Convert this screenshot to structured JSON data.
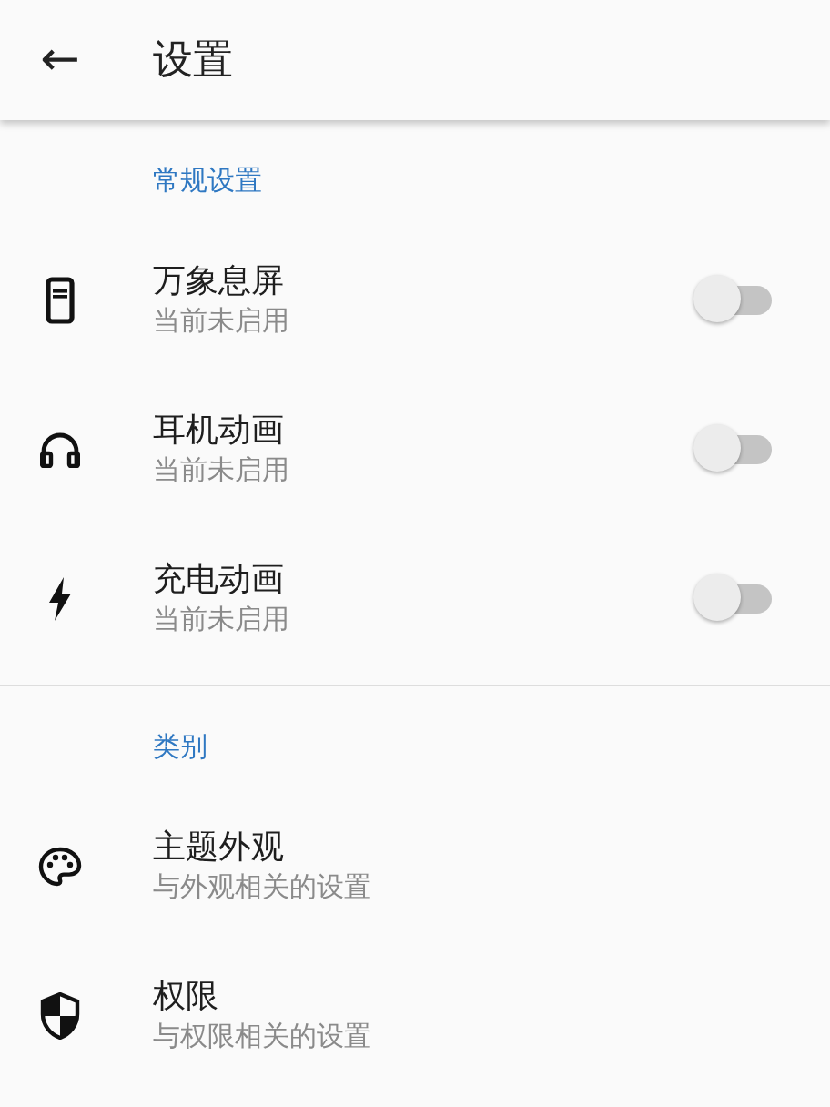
{
  "app_bar": {
    "back": "←",
    "title": "设置"
  },
  "sections": [
    {
      "header": "常规设置",
      "items": [
        {
          "kind": "switch",
          "title": "万象息屏",
          "subtitle": "当前未启用",
          "on": false
        },
        {
          "kind": "switch",
          "title": "耳机动画",
          "subtitle": "当前未启用",
          "on": false
        },
        {
          "kind": "switch",
          "title": "充电动画",
          "subtitle": "当前未启用",
          "on": false
        }
      ]
    },
    {
      "header": "类别",
      "items": [
        {
          "kind": "link",
          "title": "主题外观",
          "subtitle": "与外观相关的设置"
        },
        {
          "kind": "link",
          "title": "权限",
          "subtitle": "与权限相关的设置"
        }
      ]
    }
  ]
}
